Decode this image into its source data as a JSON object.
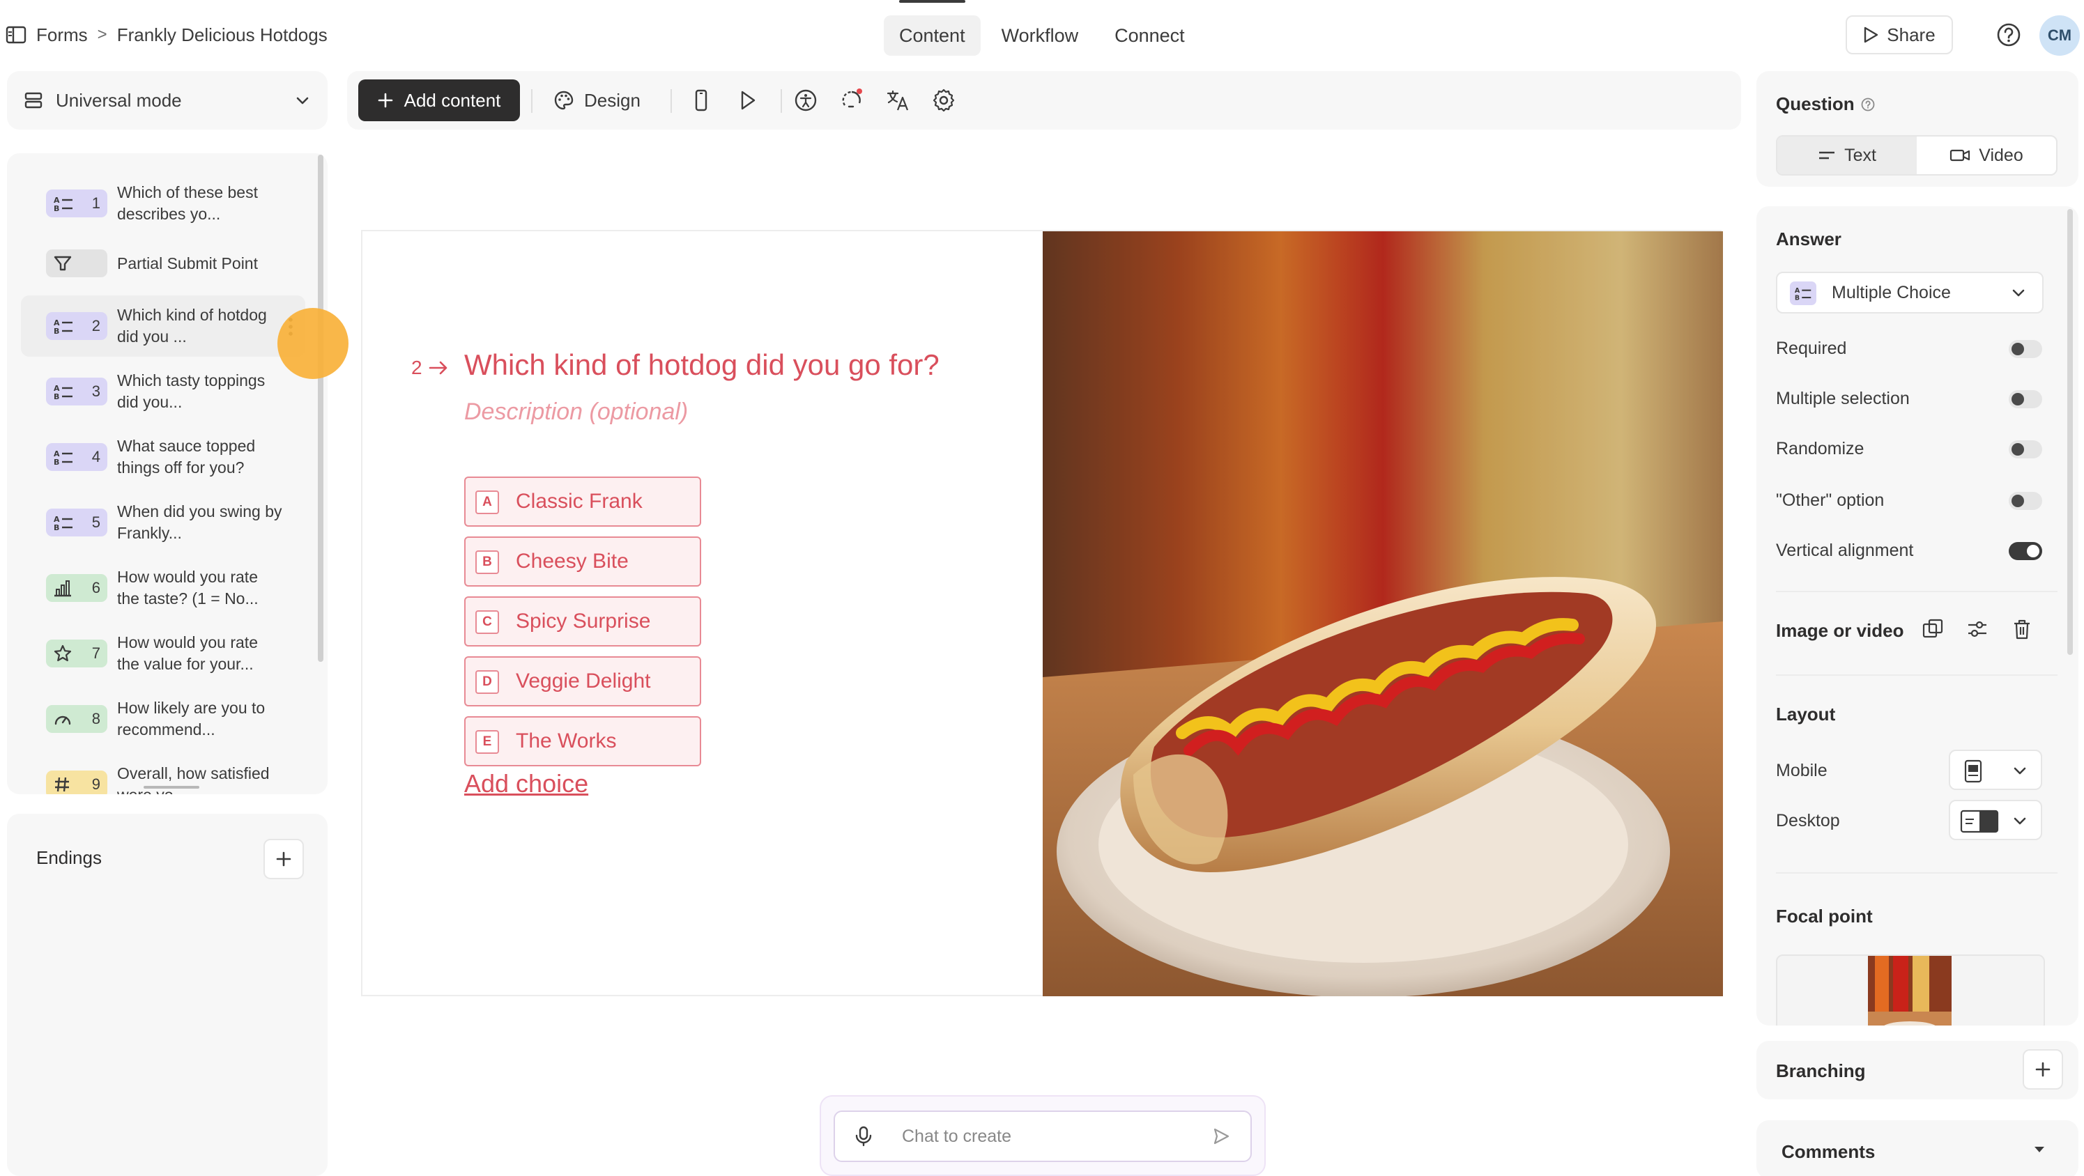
{
  "breadcrumb": {
    "root": "Forms",
    "separator": ">",
    "current": "Frankly Delicious Hotdogs"
  },
  "nav": {
    "tabs": [
      {
        "label": "Content",
        "active": true
      },
      {
        "label": "Workflow"
      },
      {
        "label": "Connect"
      }
    ]
  },
  "header": {
    "share_label": "Share",
    "avatar_initials": "CM"
  },
  "mode": {
    "label": "Universal mode"
  },
  "questions": [
    {
      "number": "1",
      "text": "Which of these best describes yo...",
      "icon": "multiple-choice-icon",
      "color": "purple"
    },
    {
      "number": "",
      "text": "Partial Submit Point",
      "icon": "partial-submit-icon",
      "color": "grey"
    },
    {
      "number": "2",
      "text": "Which kind of hotdog did you ...",
      "icon": "multiple-choice-icon",
      "color": "purple",
      "active": true
    },
    {
      "number": "3",
      "text": "Which tasty toppings did you...",
      "icon": "multiple-choice-icon",
      "color": "purple"
    },
    {
      "number": "4",
      "text": "What sauce topped things off for you?",
      "icon": "multiple-choice-icon",
      "color": "purple"
    },
    {
      "number": "5",
      "text": "When did you swing by Frankly...",
      "icon": "multiple-choice-icon",
      "color": "purple"
    },
    {
      "number": "6",
      "text": "How would you rate the taste? (1 = No...",
      "icon": "bar-chart-icon",
      "color": "green"
    },
    {
      "number": "7",
      "text": "How would you rate the value for your...",
      "icon": "star-icon",
      "color": "green"
    },
    {
      "number": "8",
      "text": "How likely are you to recommend...",
      "icon": "gauge-icon",
      "color": "green"
    },
    {
      "number": "9",
      "text": "Overall, how satisfied were yo...",
      "icon": "hash-icon",
      "color": "yellow"
    }
  ],
  "endings": {
    "title": "Endings"
  },
  "toolbar": {
    "add_content_label": "Add content",
    "design_label": "Design"
  },
  "editor": {
    "question_number": "2",
    "question_title": "Which kind of hotdog did you go for?",
    "description_placeholder": "Description (optional)",
    "choices": [
      {
        "key": "A",
        "label": "Classic Frank"
      },
      {
        "key": "B",
        "label": "Cheesy Bite"
      },
      {
        "key": "C",
        "label": "Spicy Surprise"
      },
      {
        "key": "D",
        "label": "Veggie Delight"
      },
      {
        "key": "E",
        "label": "The Works"
      }
    ],
    "add_choice_label": "Add choice",
    "accent_color": "#d94f5c"
  },
  "chat": {
    "placeholder": "Chat to create"
  },
  "right_panel": {
    "question_title": "Question",
    "question_modes": [
      {
        "label": "Text",
        "active": true
      },
      {
        "label": "Video"
      }
    ],
    "answer_title": "Answer",
    "answer_type": "Multiple Choice",
    "settings": [
      {
        "label": "Required",
        "on": false
      },
      {
        "label": "Multiple selection",
        "on": false
      },
      {
        "label": "Randomize",
        "on": false
      },
      {
        "label": "\"Other\" option",
        "on": false
      },
      {
        "label": "Vertical alignment",
        "on": true
      }
    ],
    "image_label": "Image or video",
    "layout_title": "Layout",
    "layout_mobile": "Mobile",
    "layout_desktop": "Desktop",
    "focal_title": "Focal point",
    "branching_title": "Branching",
    "comments_title": "Comments"
  }
}
